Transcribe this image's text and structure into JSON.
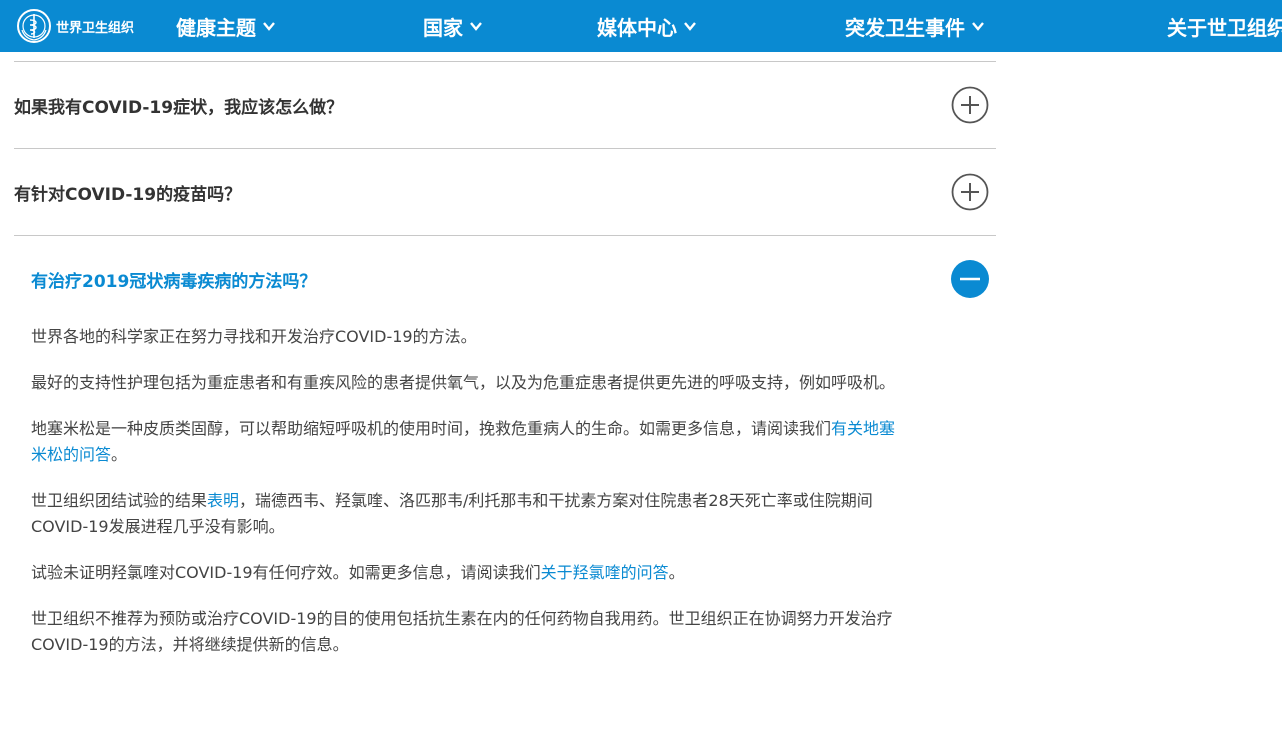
{
  "colors": {
    "brand": "#0a8ad2",
    "text": "#333333",
    "body_text": "#444444",
    "divider": "#c8c8c8"
  },
  "header": {
    "logo_text": "世界卫生组织",
    "logo_icon": "who-emblem-icon",
    "nav": [
      {
        "label": "健康主题",
        "icon": "chevron-down-icon"
      },
      {
        "label": "国家",
        "icon": "chevron-down-icon"
      },
      {
        "label": "媒体中心",
        "icon": "chevron-down-icon"
      },
      {
        "label": "突发卫生事件",
        "icon": "chevron-down-icon"
      },
      {
        "label": "关于世卫组织"
      }
    ]
  },
  "faq": {
    "collapsed": [
      {
        "question": "如果我有COVID-19症状，我应该怎么做？",
        "icon": "plus-circle-icon"
      },
      {
        "question": "有针对COVID-19的疫苗吗？",
        "icon": "plus-circle-icon"
      }
    ],
    "expanded": {
      "question": "有治疗2019冠状病毒疾病的方法吗？",
      "icon": "minus-circle-icon",
      "paragraphs": {
        "p1": "世界各地的科学家正在努力寻找和开发治疗COVID-19的方法。",
        "p2": "最好的支持性护理包括为重症患者和有重疾风险的患者提供氧气，以及为危重症患者提供更先进的呼吸支持，例如呼吸机。",
        "p3_before": "地塞米松是一种皮质类固醇，可以帮助缩短呼吸机的使用时间，挽救危重病人的生命。如需更多信息，请阅读我们",
        "p3_link": "有关地塞米松的问答",
        "p3_after": "。",
        "p4_before": "世卫组织团结试验的结果",
        "p4_link": "表明",
        "p4_after": "，瑞德西韦、羟氯喹、洛匹那韦/利托那韦和干扰素方案对住院患者28天死亡率或住院期间COVID-19发展进程几乎没有影响。",
        "p5_before": "试验未证明羟氯喹对COVID-19有任何疗效。如需更多信息，请阅读我们",
        "p5_link": "关于羟氯喹的问答",
        "p5_after": "。",
        "p6": "世卫组织不推荐为预防或治疗COVID-19的目的使用包括抗生素在内的任何药物自我用药。世卫组织正在协调努力开发治疗COVID-19的方法，并将继续提供新的信息。"
      }
    }
  }
}
